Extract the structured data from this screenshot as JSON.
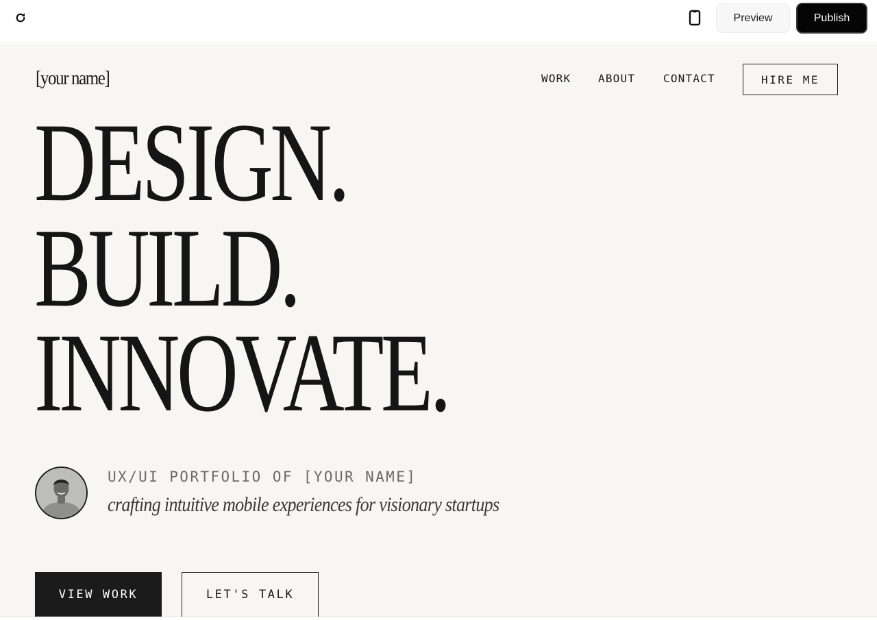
{
  "toolbar": {
    "refresh_icon": "refresh-icon",
    "device_icon": "mobile-device-icon",
    "preview_label": "Preview",
    "publish_label": "Publish"
  },
  "site": {
    "logo": "[your name]",
    "nav": {
      "work": "WORK",
      "about": "ABOUT",
      "contact": "CONTACT",
      "hire": "HIRE ME"
    },
    "headline": [
      "DESIGN.",
      "BUILD.",
      "INNOVATE."
    ],
    "avatar_icon": "profile-photo",
    "subtitle": "UX/UI PORTFOLIO OF [YOUR NAME]",
    "tagline": "crafting intuitive mobile experiences for visionary startups",
    "cta_primary": "VIEW WORK",
    "cta_secondary": "LET'S TALK"
  },
  "colors": {
    "canvas_bg": "#f7f6f2",
    "ink": "#1a1a1a",
    "publish_bg": "#050505"
  }
}
